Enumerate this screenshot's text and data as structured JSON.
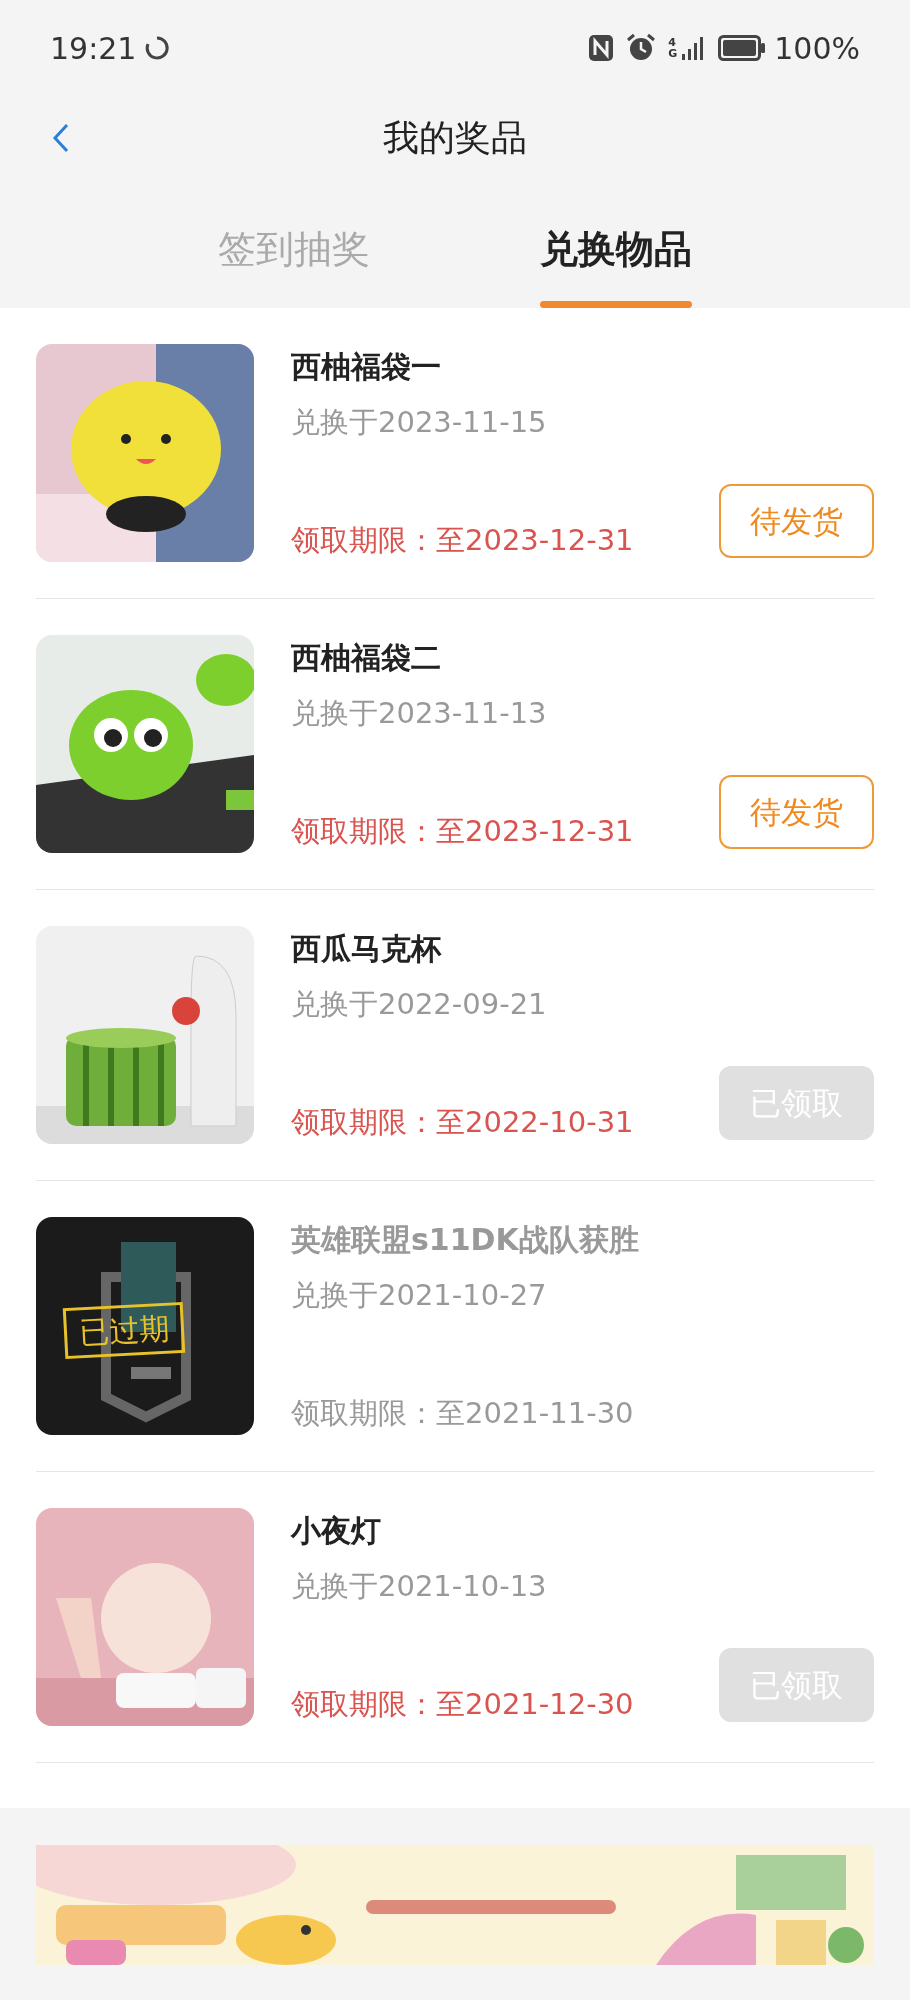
{
  "status_bar": {
    "time": "19:21",
    "network": "4G",
    "battery": "100%"
  },
  "header": {
    "title": "我的奖品"
  },
  "tabs": [
    {
      "label": "签到抽奖",
      "selected": false
    },
    {
      "label": "兑换物品",
      "selected": true
    }
  ],
  "items": [
    {
      "kind": "pending",
      "title": "西柚福袋一",
      "date": "兑换于2023-11-15",
      "deadline": "领取期限：至2023-12-31",
      "action": "待发货"
    },
    {
      "kind": "pending",
      "title": "西柚福袋二",
      "date": "兑换于2023-11-13",
      "deadline": "领取期限：至2023-12-31",
      "action": "待发货"
    },
    {
      "kind": "claimed",
      "title": "西瓜马克杯",
      "date": "兑换于2022-09-21",
      "deadline": "领取期限：至2022-10-31",
      "action": "已领取"
    },
    {
      "kind": "expired",
      "title": "英雄联盟s11DK战队获胜",
      "date": "兑换于2021-10-27",
      "deadline": "领取期限：至2021-11-30",
      "stamp": "已过期"
    },
    {
      "kind": "claimed",
      "title": "小夜灯",
      "date": "兑换于2021-10-13",
      "deadline": "领取期限：至2021-12-30",
      "action": "已领取"
    }
  ]
}
